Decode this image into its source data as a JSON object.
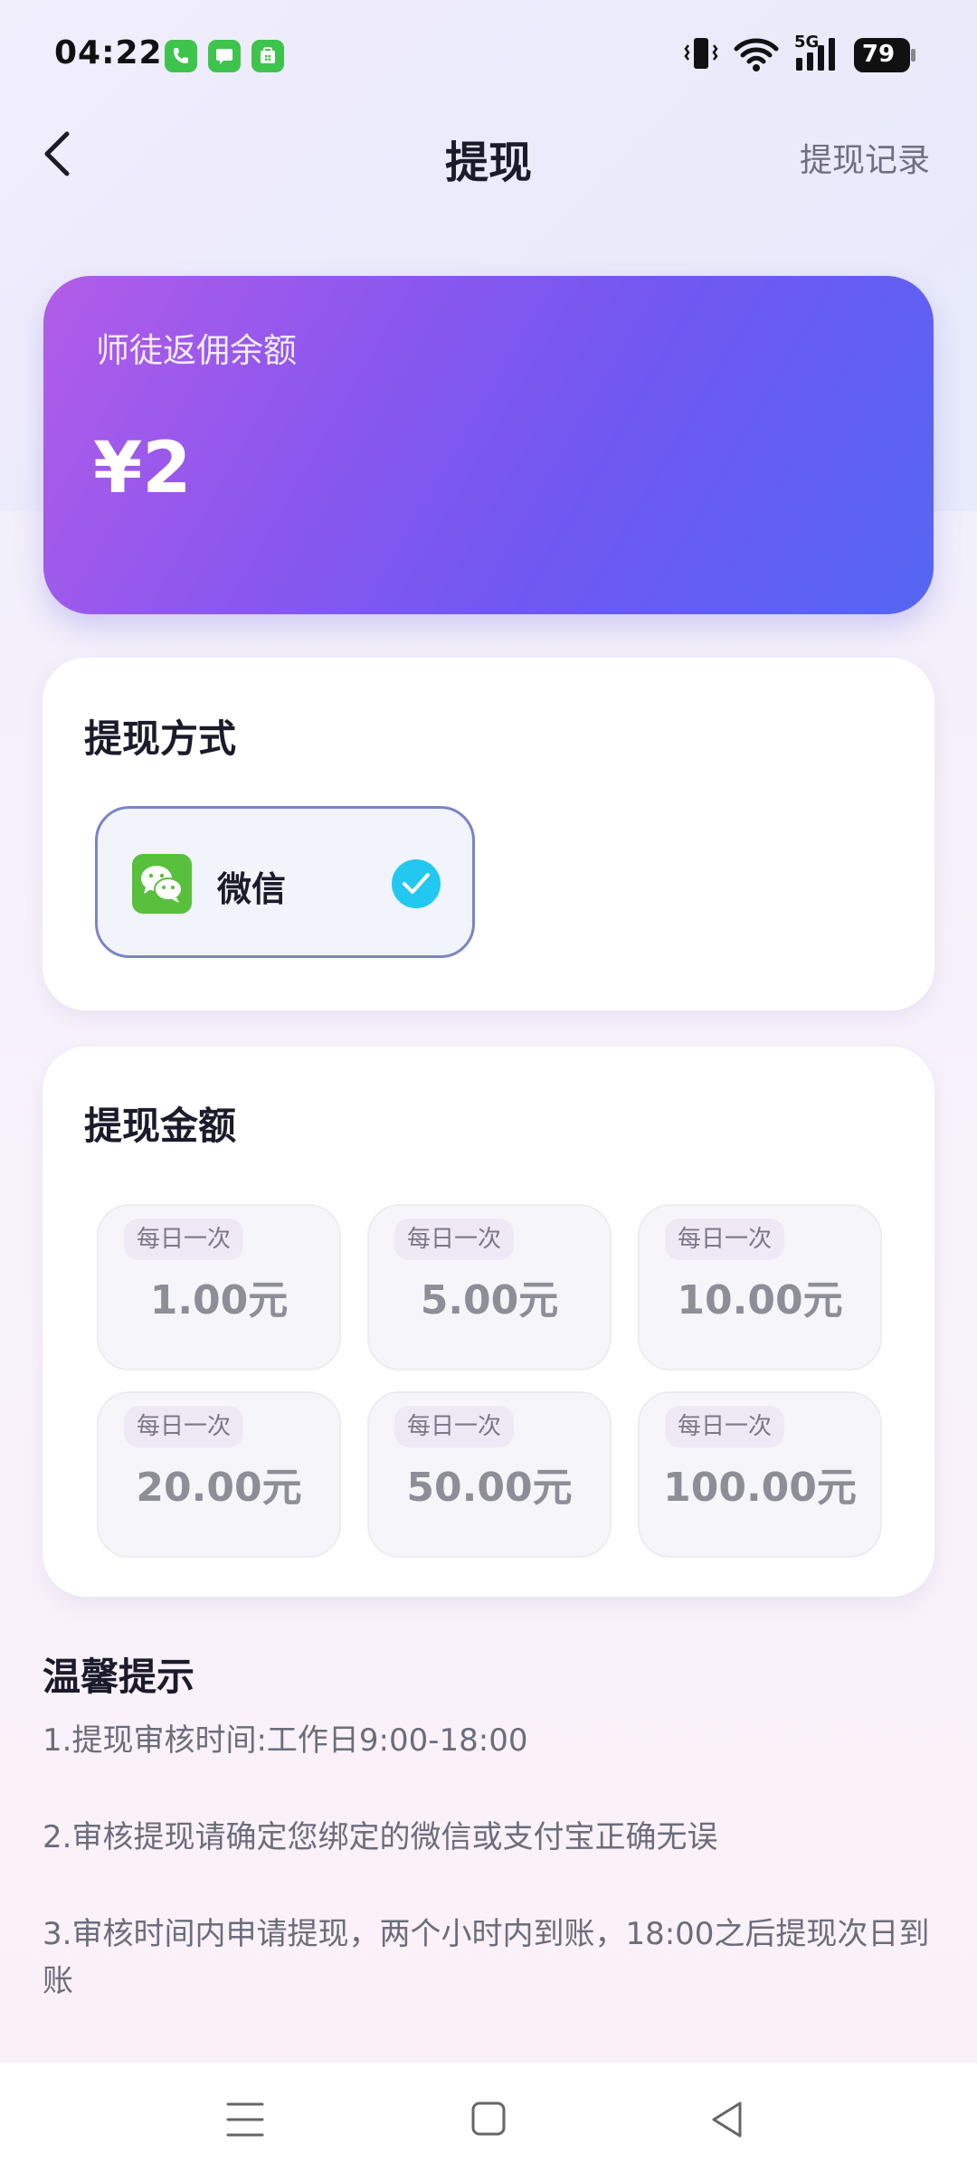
{
  "status": {
    "time": "04:22",
    "network": "5G",
    "battery": "79"
  },
  "header": {
    "title": "提现",
    "records_link": "提现记录"
  },
  "balance": {
    "label": "师徒返佣余额",
    "amount": "¥2"
  },
  "method_section": {
    "title": "提现方式",
    "option_label": "微信"
  },
  "amount_section": {
    "title": "提现金额",
    "options": [
      {
        "tag": "每日一次",
        "value": "1.00元"
      },
      {
        "tag": "每日一次",
        "value": "5.00元"
      },
      {
        "tag": "每日一次",
        "value": "10.00元"
      },
      {
        "tag": "每日一次",
        "value": "20.00元"
      },
      {
        "tag": "每日一次",
        "value": "50.00元"
      },
      {
        "tag": "每日一次",
        "value": "100.00元"
      }
    ]
  },
  "tips": {
    "title": "温馨提示",
    "lines": [
      "1.提现审核时间:工作日9:00-18:00",
      "2.审核提现请确定您绑定的微信或支付宝正确无误",
      "3.审核时间内申请提现，两个小时内到账，18:00之后提现次日到账"
    ]
  },
  "colors": {
    "accent_start": "#b25ce8",
    "accent_end": "#5566f3",
    "check": "#22c8f0",
    "wechat": "#58c03c"
  }
}
